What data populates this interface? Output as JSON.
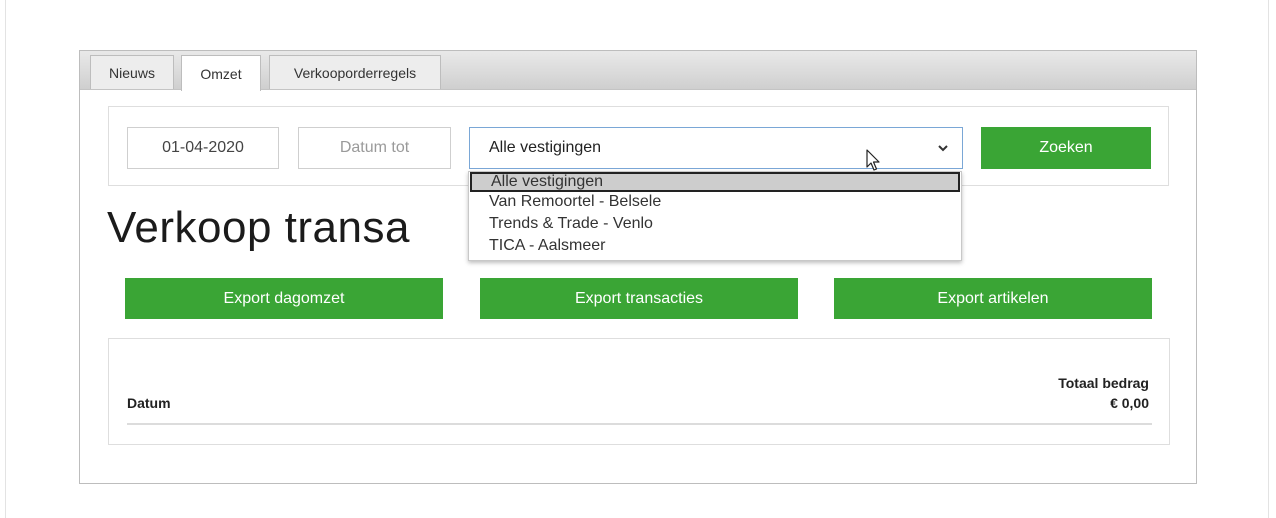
{
  "tabs": [
    {
      "label": "Nieuws",
      "active": false
    },
    {
      "label": "Omzet",
      "active": true
    },
    {
      "label": "Verkooporderregels",
      "active": false
    }
  ],
  "filters": {
    "date_from_value": "01-04-2020",
    "date_to_placeholder": "Datum tot",
    "location_selected": "Alle vestigingen",
    "location_options": [
      "Alle vestigingen",
      "Van Remoortel - Belsele",
      "Trends & Trade - Venlo",
      "TICA - Aalsmeer"
    ],
    "search_label": "Zoeken"
  },
  "heading": "Verkoop transa",
  "exports": [
    "Export dagomzet",
    "Export transacties",
    "Export artikelen"
  ],
  "table": {
    "col_date": "Datum",
    "col_total_label": "Totaal bedrag",
    "col_total_value": "€ 0,00"
  },
  "colors": {
    "accent_green": "#3aa535",
    "select_border": "#7aa7d6"
  },
  "icons": [
    "chevron-down-icon",
    "mouse-cursor-icon"
  ]
}
